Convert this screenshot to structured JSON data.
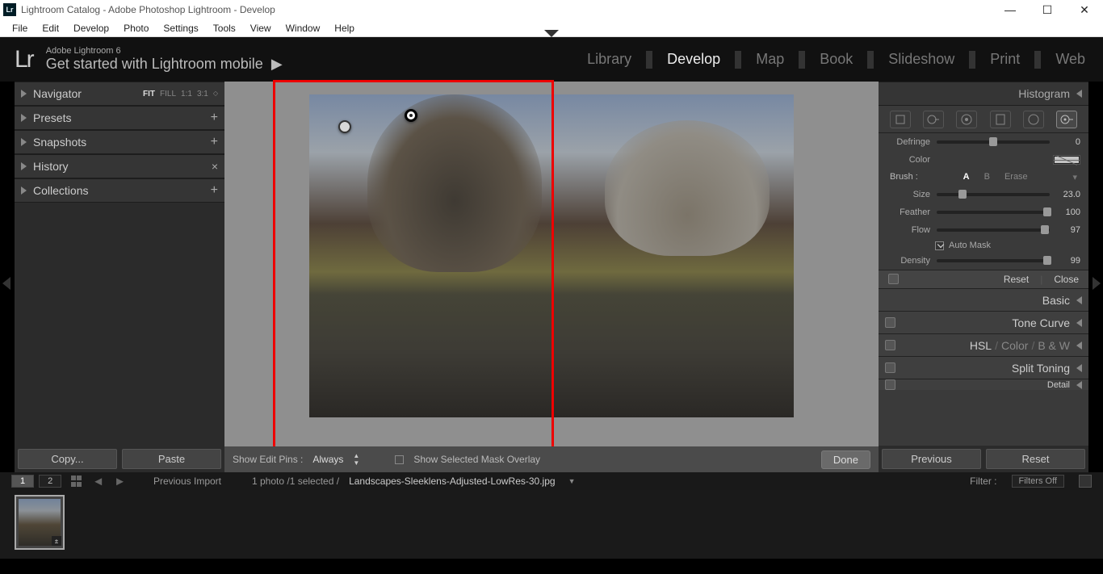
{
  "title": "Lightroom Catalog - Adobe Photoshop Lightroom - Develop",
  "menubar": [
    "File",
    "Edit",
    "Develop",
    "Photo",
    "Settings",
    "Tools",
    "View",
    "Window",
    "Help"
  ],
  "topbar": {
    "logo": "Lr",
    "subtitle": "Adobe Lightroom 6",
    "mobile_prompt": "Get started with Lightroom mobile",
    "modules": [
      "Library",
      "Develop",
      "Map",
      "Book",
      "Slideshow",
      "Print",
      "Web"
    ],
    "active_module": "Develop"
  },
  "left_panel": {
    "navigator": "Navigator",
    "nav_modes": [
      "FIT",
      "FILL",
      "1:1",
      "3:1"
    ],
    "nav_selected": "FIT",
    "sections": [
      "Presets",
      "Snapshots",
      "History",
      "Collections"
    ],
    "copy_btn": "Copy...",
    "paste_btn": "Paste"
  },
  "center": {
    "show_pins_label": "Show Edit Pins :",
    "show_pins_value": "Always",
    "overlay_label": "Show Selected Mask Overlay",
    "done_btn": "Done"
  },
  "right_panel": {
    "histogram": "Histogram",
    "defringe_label": "Defringe",
    "defringe_val": "0",
    "color_label": "Color",
    "brush_label": "Brush :",
    "brush_modes": [
      "A",
      "B",
      "Erase"
    ],
    "brush_sel": "A",
    "size_label": "Size",
    "size_val": "23.0",
    "feather_label": "Feather",
    "feather_val": "100",
    "flow_label": "Flow",
    "flow_val": "97",
    "automask_label": "Auto Mask",
    "density_label": "Density",
    "density_val": "99",
    "reset_btn": "Reset",
    "close_btn": "Close",
    "sections": [
      "Basic",
      "Tone Curve",
      "HSL  /  Color  /  B & W",
      "Split Toning",
      "Detail"
    ],
    "prev_btn": "Previous",
    "reset_btn2": "Reset"
  },
  "bottombar": {
    "previous_import": "Previous Import",
    "count_text": "1 photo /1 selected /",
    "filename": "Landscapes-Sleeklens-Adjusted-LowRes-30.jpg",
    "filter_label": "Filter :",
    "filter_value": "Filters Off"
  }
}
